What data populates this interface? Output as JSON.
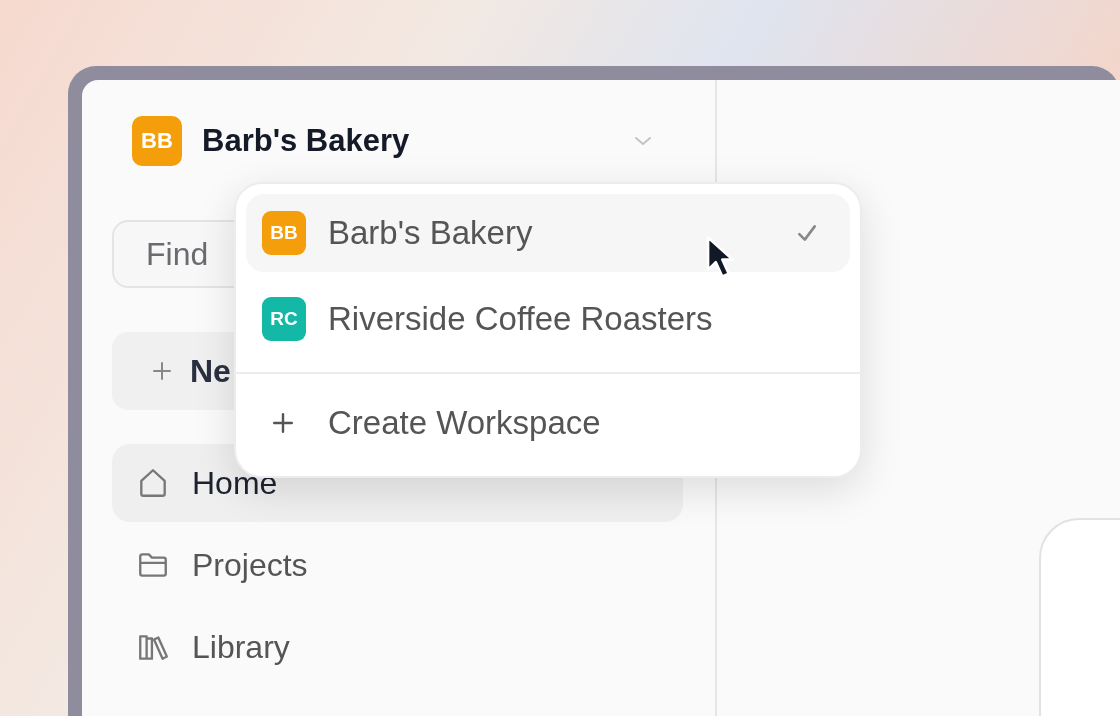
{
  "workspace": {
    "initials": "BB",
    "name": "Barb's Bakery",
    "color": "#f59e0b"
  },
  "search": {
    "placeholder": "Find"
  },
  "new_button": {
    "label": "Ne"
  },
  "nav": [
    {
      "label": "Home",
      "kind": "home",
      "selected": true
    },
    {
      "label": "Projects",
      "kind": "folder",
      "selected": false
    },
    {
      "label": "Library",
      "kind": "library",
      "selected": false
    }
  ],
  "workspace_menu": {
    "items": [
      {
        "initials": "BB",
        "name": "Barb's Bakery",
        "color": "#f59e0b",
        "selected": true
      },
      {
        "initials": "RC",
        "name": "Riverside Coffee Roasters",
        "color": "#14b8a6",
        "selected": false
      }
    ],
    "create_label": "Create Workspace"
  }
}
